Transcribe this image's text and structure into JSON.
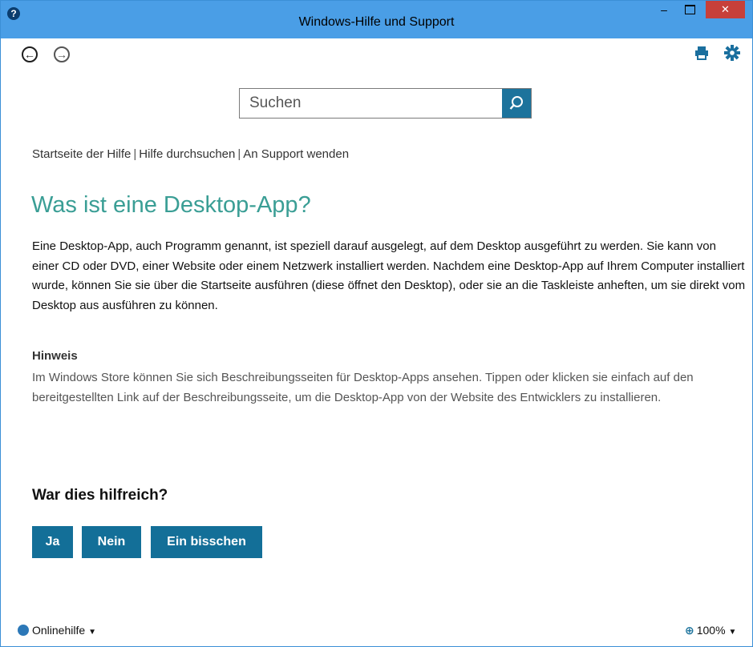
{
  "window": {
    "title": "Windows-Hilfe und Support",
    "help_icon": "?",
    "minimize_glyph": "–",
    "close_glyph": "✕"
  },
  "toolbar": {
    "back_glyph": "←",
    "forward_glyph": "→",
    "icons": [
      "back-icon",
      "forward-icon",
      "print-icon",
      "gear-icon"
    ]
  },
  "search": {
    "placeholder": "Suchen",
    "value": ""
  },
  "breadcrumb": {
    "items": [
      "Startseite der Hilfe",
      "Hilfe durchsuchen",
      "An Support wenden"
    ],
    "separator": "|"
  },
  "article": {
    "title": "Was ist eine Desktop-App?",
    "body": "Eine Desktop-App, auch Programm genannt, ist speziell darauf ausgelegt, auf dem Desktop ausgeführt zu werden. Sie kann von einer CD oder DVD, einer Website oder einem Netzwerk installiert werden. Nachdem eine Desktop-App auf Ihrem Computer installiert wurde, können Sie sie über die Startseite ausführen (diese öffnet den Desktop), oder sie an die Taskleiste anheften, um sie direkt vom Desktop aus ausführen zu können.",
    "note_heading": "Hinweis",
    "note_text": "Im Windows Store können Sie sich Beschreibungsseiten für Desktop-Apps ansehen. Tippen oder klicken sie einfach auf den bereitgestellten Link auf der Beschreibungsseite, um die Desktop-App von der Website des Entwicklers zu installieren."
  },
  "feedback": {
    "question": "War dies hilfreich?",
    "yes_label": "Ja",
    "no_label": "Nein",
    "some_label": "Ein bisschen"
  },
  "statusbar": {
    "online_help_label": "Onlinehilfe",
    "zoom": "100%"
  },
  "colors": {
    "accent": "#1c739c",
    "title_bar": "#4a9ee6",
    "close_button": "#c7403a",
    "heading": "#3a9e95"
  }
}
